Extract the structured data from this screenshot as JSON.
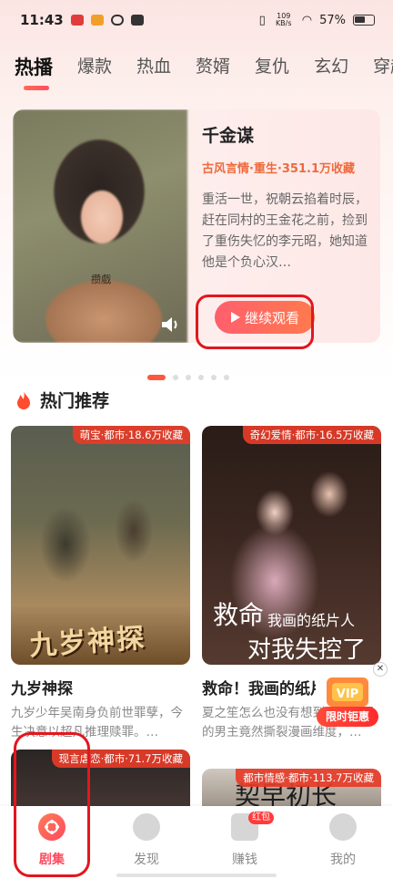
{
  "status_bar": {
    "time": "11:43",
    "net_speed": "109 KB/s",
    "battery": "57%"
  },
  "tabs": [
    {
      "label": "热播",
      "active": true
    },
    {
      "label": "爆款"
    },
    {
      "label": "热血"
    },
    {
      "label": "赘婿"
    },
    {
      "label": "复仇"
    },
    {
      "label": "玄幻"
    },
    {
      "label": "穿越"
    }
  ],
  "hero": {
    "watermark": "攒戲",
    "title": "千金谋",
    "tags": "古风言情·重生·351.1万收藏",
    "description": "重活一世，祝朝云掐着时辰，赶在同村的王金花之前，捡到了重伤失忆的李元昭，她知道他是个负心汉…",
    "play_label": "继续观看"
  },
  "pager": {
    "count": 6,
    "active": 0
  },
  "section": {
    "title": "热门推荐"
  },
  "cards": [
    {
      "badge": "萌宝·都市·18.6万收藏",
      "poster_text": "九岁神探",
      "title": "九岁神探",
      "desc": "九岁少年吴南身负前世罪孽，今生决意以超凡推理赎罪。…"
    },
    {
      "badge": "奇幻爱情·都市·16.5万收藏",
      "poster_text": "救命",
      "poster_sub": "我画的纸片人",
      "poster_text2": "对我失控了",
      "title": "救命！我画的纸片人对我失控了",
      "desc": "夏之笙怎么也没有想到，自己画的男主竟然撕裂漫画维度，…"
    },
    {
      "badge": "现言虐恋·都市·71.7万收藏"
    },
    {
      "badge": "都市情感·都市·113.7万收藏",
      "poster_text": "契早初长"
    }
  ],
  "vip": {
    "label": "限时钜惠",
    "close": "✕"
  },
  "bottom_nav": {
    "items": [
      {
        "label": "剧集",
        "icon": "film-reel-icon",
        "active": true
      },
      {
        "label": "发现",
        "icon": "planet-icon"
      },
      {
        "label": "赚钱",
        "icon": "gift-icon",
        "badge": "红包"
      },
      {
        "label": "我的",
        "icon": "profile-icon"
      }
    ]
  },
  "colors": {
    "accent": "#ff4b5f",
    "tag_orange": "#ee6a3c",
    "highlight_red": "#e3161e"
  }
}
